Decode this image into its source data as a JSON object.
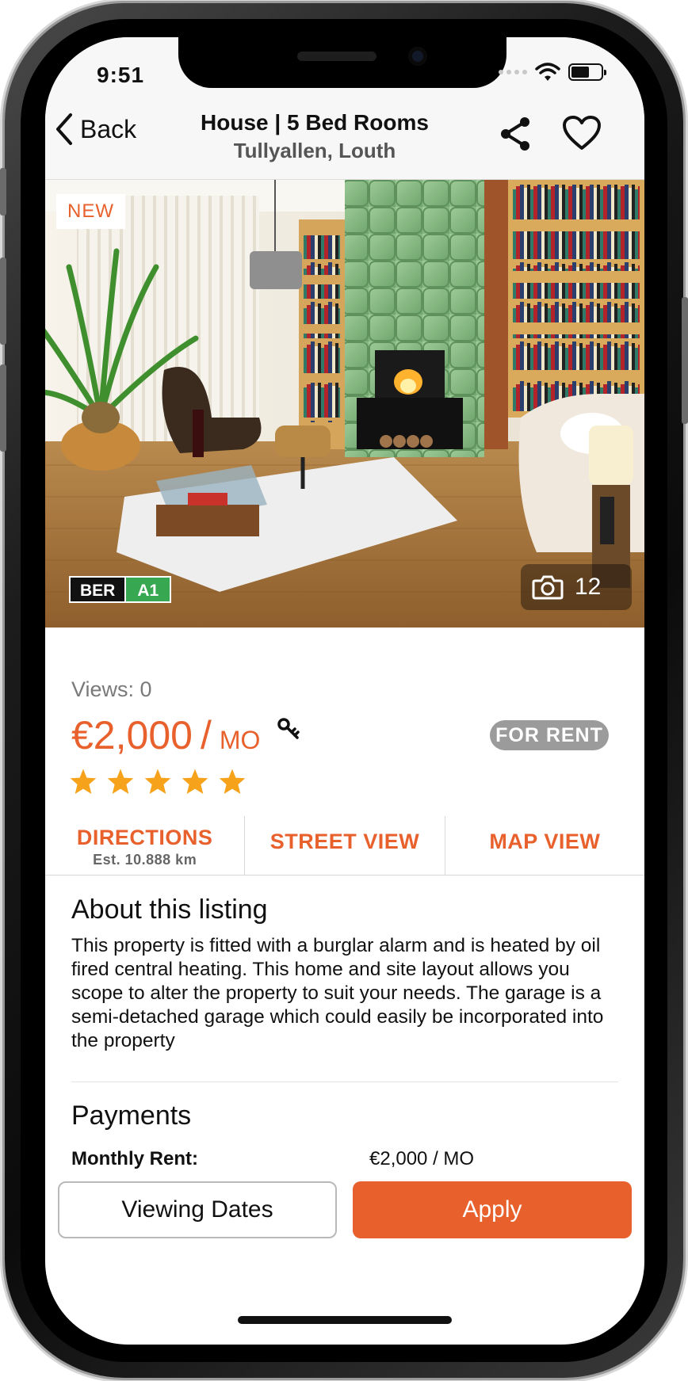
{
  "status_bar": {
    "time": "9:51"
  },
  "nav": {
    "back_label": "Back",
    "title": "House | 5 Bed Rooms",
    "subtitle": "Tullyallen, Louth",
    "icons": [
      "chevron-left-icon",
      "share-icon",
      "heart-icon"
    ]
  },
  "hero": {
    "badge": "NEW",
    "ber_label": "BER",
    "ber_rating": "A1",
    "photo_count": "12",
    "colors": {
      "ber_rating_bg": "#37a851",
      "badge_text": "#e8612c"
    }
  },
  "listing": {
    "views": "Views: 0",
    "price": "€2,000",
    "price_separator": "/",
    "price_unit": "MO",
    "status_badge": "FOR RENT",
    "rating": {
      "stars": 5,
      "max": 5
    }
  },
  "actions": [
    {
      "label": "DIRECTIONS",
      "sublabel": "Est. 10.888 km"
    },
    {
      "label": "STREET VIEW"
    },
    {
      "label": "MAP VIEW"
    }
  ],
  "about": {
    "title": "About this listing",
    "body": "This property is fitted with a burglar alarm and is heated by oil fired central heating. This home and site layout allows you scope to alter the property to suit your needs. The garage is a semi-detached garage which could easily be incorporated into the property"
  },
  "payments": {
    "title": "Payments",
    "monthly_rent_label": "Monthly Rent:",
    "monthly_rent_value": "€2,000 / MO"
  },
  "buttons": {
    "viewing_dates": "Viewing Dates",
    "apply": "Apply"
  },
  "colors": {
    "accent": "#e8612c",
    "star": "#f6a21a",
    "status_badge": "#9b9b9b"
  }
}
